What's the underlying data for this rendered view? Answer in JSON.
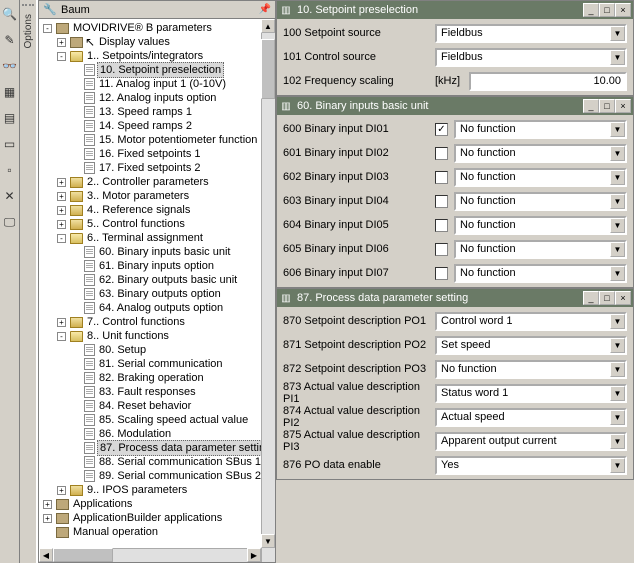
{
  "left_toolbar": {
    "icons": [
      "search-icon",
      "eyedrop-icon",
      "grid1-icon",
      "grid2-icon",
      "window-icon",
      "blank-icon",
      "cancel-icon",
      "monitor-icon"
    ]
  },
  "options_label": "Options",
  "tree": {
    "title": "Baum",
    "root": {
      "label": "MOVIDRIVE® B parameters",
      "children": [
        {
          "label": "Display values",
          "icon": "book",
          "expander": "+"
        },
        {
          "label": "1.. Setpoints/integrators",
          "icon": "folder-open",
          "expander": "-",
          "children": [
            {
              "label": "10. Setpoint preselection",
              "icon": "page",
              "selected": true
            },
            {
              "label": "11. Analog input 1 (0-10V)",
              "icon": "page"
            },
            {
              "label": "12. Analog inputs option",
              "icon": "page"
            },
            {
              "label": "13. Speed ramps 1",
              "icon": "page"
            },
            {
              "label": "14. Speed ramps 2",
              "icon": "page"
            },
            {
              "label": "15. Motor potentiometer function",
              "icon": "page"
            },
            {
              "label": "16. Fixed setpoints 1",
              "icon": "page"
            },
            {
              "label": "17. Fixed setpoints 2",
              "icon": "page"
            }
          ]
        },
        {
          "label": "2.. Controller parameters",
          "icon": "folder-closed",
          "expander": "+"
        },
        {
          "label": "3.. Motor parameters",
          "icon": "folder-closed",
          "expander": "+"
        },
        {
          "label": "4.. Reference signals",
          "icon": "folder-closed",
          "expander": "+"
        },
        {
          "label": "5.. Control functions",
          "icon": "folder-closed",
          "expander": "+"
        },
        {
          "label": "6.. Terminal assignment",
          "icon": "folder-open",
          "expander": "-",
          "children": [
            {
              "label": "60. Binary inputs basic unit",
              "icon": "page"
            },
            {
              "label": "61. Binary inputs option",
              "icon": "page"
            },
            {
              "label": "62. Binary outputs basic unit",
              "icon": "page"
            },
            {
              "label": "63. Binary outputs option",
              "icon": "page"
            },
            {
              "label": "64. Analog outputs option",
              "icon": "page"
            }
          ]
        },
        {
          "label": "7.. Control functions",
          "icon": "folder-closed",
          "expander": "+"
        },
        {
          "label": "8.. Unit functions",
          "icon": "folder-open",
          "expander": "-",
          "children": [
            {
              "label": "80. Setup",
              "icon": "page"
            },
            {
              "label": "81. Serial communication",
              "icon": "page"
            },
            {
              "label": "82. Braking operation",
              "icon": "page"
            },
            {
              "label": "83. Fault responses",
              "icon": "page"
            },
            {
              "label": "84. Reset behavior",
              "icon": "page"
            },
            {
              "label": "85. Scaling speed actual value",
              "icon": "page"
            },
            {
              "label": "86. Modulation",
              "icon": "page"
            },
            {
              "label": "87. Process data parameter settin",
              "icon": "page",
              "selected": true
            },
            {
              "label": "88. Serial communication SBus 1",
              "icon": "page"
            },
            {
              "label": "89. Serial communication SBus 2",
              "icon": "page"
            }
          ]
        },
        {
          "label": "9.. IPOS parameters",
          "icon": "folder-closed",
          "expander": "+"
        }
      ]
    },
    "siblings": [
      {
        "label": "Applications",
        "icon": "book",
        "expander": "+"
      },
      {
        "label": "ApplicationBuilder applications",
        "icon": "book",
        "expander": "+"
      },
      {
        "label": "Manual operation",
        "icon": "book",
        "expander": ""
      }
    ]
  },
  "panel10": {
    "title": "10. Setpoint preselection",
    "rows": [
      {
        "id": "100",
        "label": "100 Setpoint source",
        "value": "Fieldbus",
        "type": "dd"
      },
      {
        "id": "101",
        "label": "101 Control source",
        "value": "Fieldbus",
        "type": "dd"
      },
      {
        "id": "102",
        "label": "102 Frequency scaling",
        "unit": "[kHz]",
        "value": "10.00",
        "type": "txt"
      }
    ]
  },
  "panel60": {
    "title": "60. Binary inputs basic unit",
    "rows": [
      {
        "id": "600",
        "label": "600 Binary input DI01",
        "value": "No function",
        "checked": true
      },
      {
        "id": "601",
        "label": "601 Binary input DI02",
        "value": "No function",
        "checked": false
      },
      {
        "id": "602",
        "label": "602 Binary input DI03",
        "value": "No function",
        "checked": false
      },
      {
        "id": "603",
        "label": "603 Binary input DI04",
        "value": "No function",
        "checked": false
      },
      {
        "id": "604",
        "label": "604 Binary input DI05",
        "value": "No function",
        "checked": false
      },
      {
        "id": "605",
        "label": "605 Binary input DI06",
        "value": "No function",
        "checked": false
      },
      {
        "id": "606",
        "label": "606 Binary input DI07",
        "value": "No function",
        "checked": false
      }
    ]
  },
  "panel87": {
    "title": "87. Process data parameter setting",
    "rows": [
      {
        "id": "870",
        "label": "870 Setpoint description PO1",
        "value": "Control word 1"
      },
      {
        "id": "871",
        "label": "871 Setpoint description PO2",
        "value": "Set speed"
      },
      {
        "id": "872",
        "label": "872 Setpoint description PO3",
        "value": "No function"
      },
      {
        "id": "873",
        "label": "873 Actual value description PI1",
        "value": "Status word 1"
      },
      {
        "id": "874",
        "label": "874 Actual value description PI2",
        "value": "Actual speed"
      },
      {
        "id": "875",
        "label": "875 Actual value description PI3",
        "value": "Apparent output current"
      },
      {
        "id": "876",
        "label": "876 PO data enable",
        "value": "Yes"
      }
    ]
  },
  "win_btn": {
    "min": "_",
    "max": "□",
    "close": "×"
  }
}
